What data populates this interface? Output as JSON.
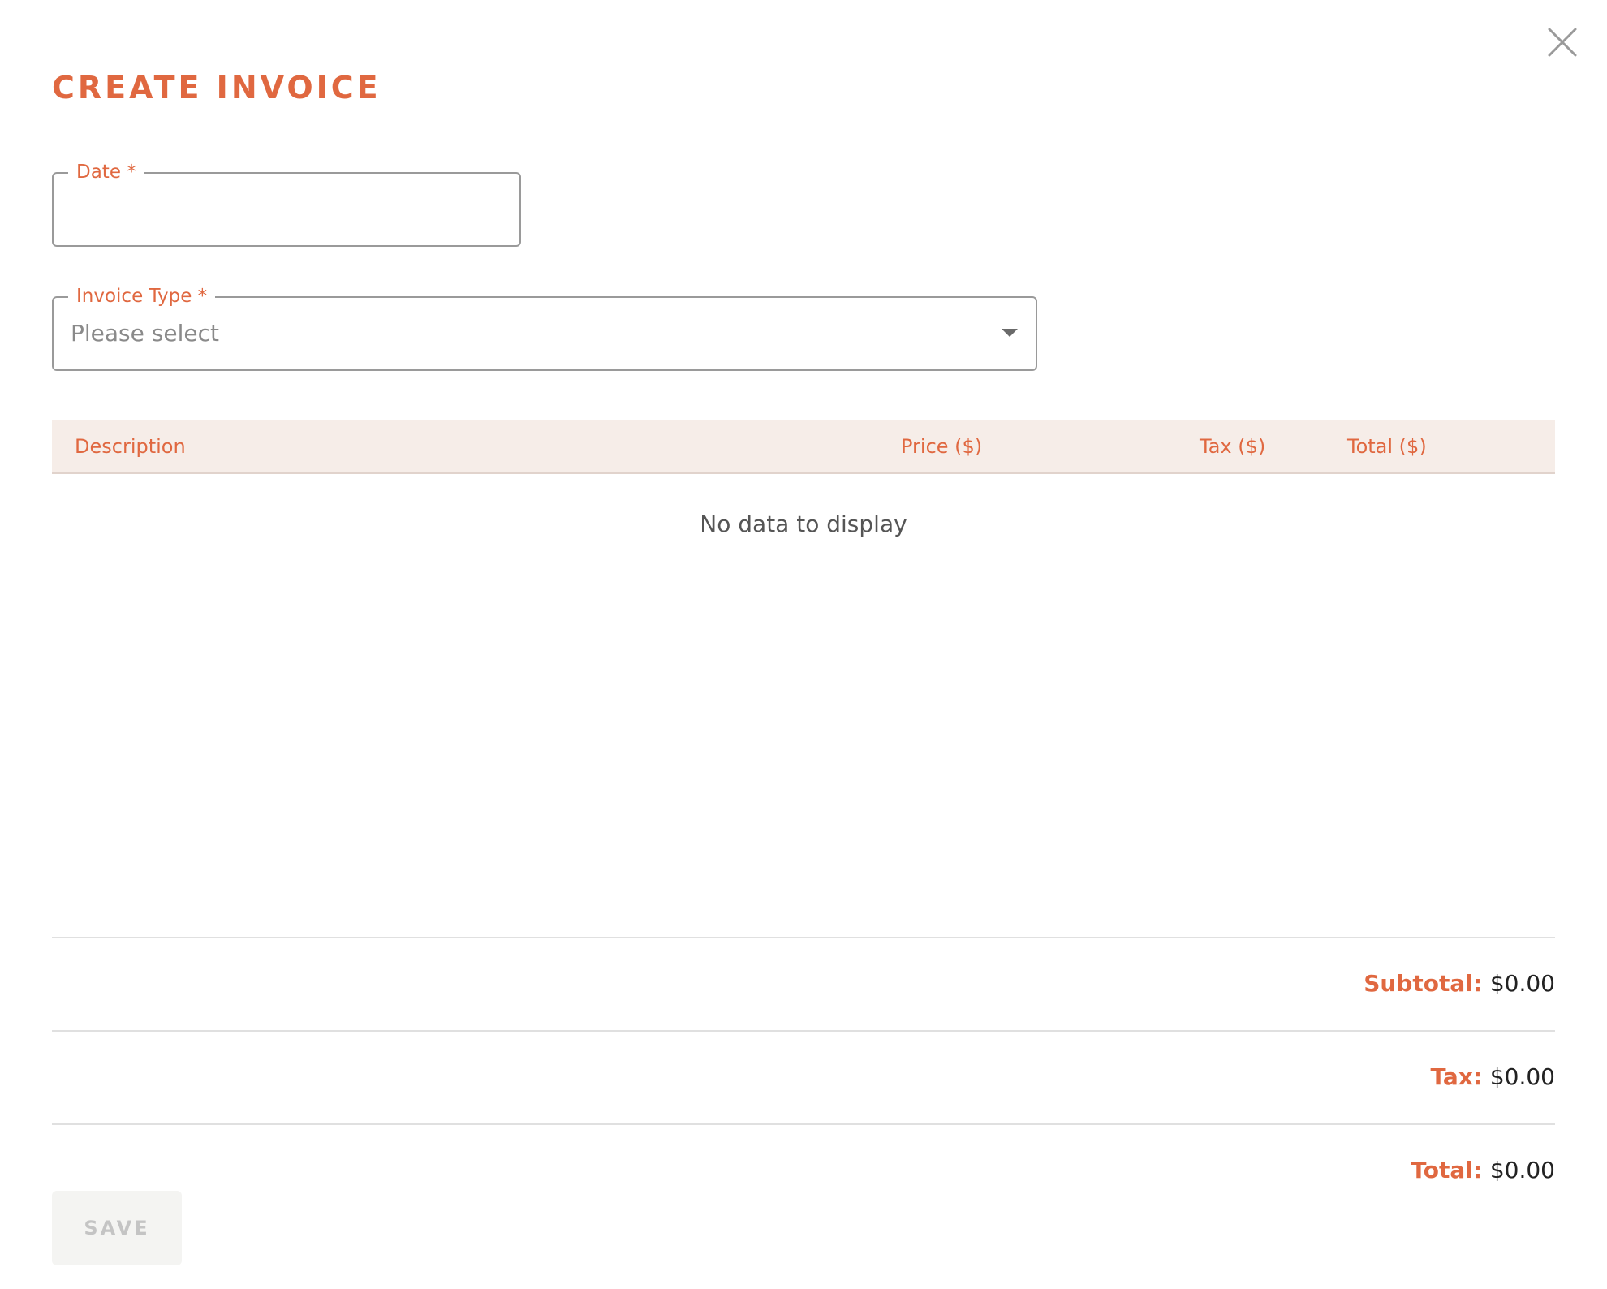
{
  "dialog": {
    "title": "CREATE INVOICE",
    "close_icon": "close-icon"
  },
  "form": {
    "date": {
      "label": "Date *",
      "value": "",
      "placeholder": ""
    },
    "invoice_type": {
      "label": "Invoice Type *",
      "selected": "Please select",
      "icon": "chevron-down-icon"
    }
  },
  "table": {
    "columns": [
      "Description",
      "Price ($)",
      "Tax ($)",
      "Total ($)"
    ],
    "rows": [],
    "empty_message": "No data to display"
  },
  "summary": {
    "subtotal_label": "Subtotal:",
    "subtotal_value": "$0.00",
    "tax_label": "Tax:",
    "tax_value": "$0.00",
    "total_label": "Total:",
    "total_value": "$0.00"
  },
  "actions": {
    "save_label": "SAVE",
    "save_enabled": false
  },
  "colors": {
    "accent": "#e06840",
    "header_bg": "#f6ede8",
    "disabled_button_bg": "#f4f4f2",
    "disabled_button_text": "#c4c4c4"
  }
}
